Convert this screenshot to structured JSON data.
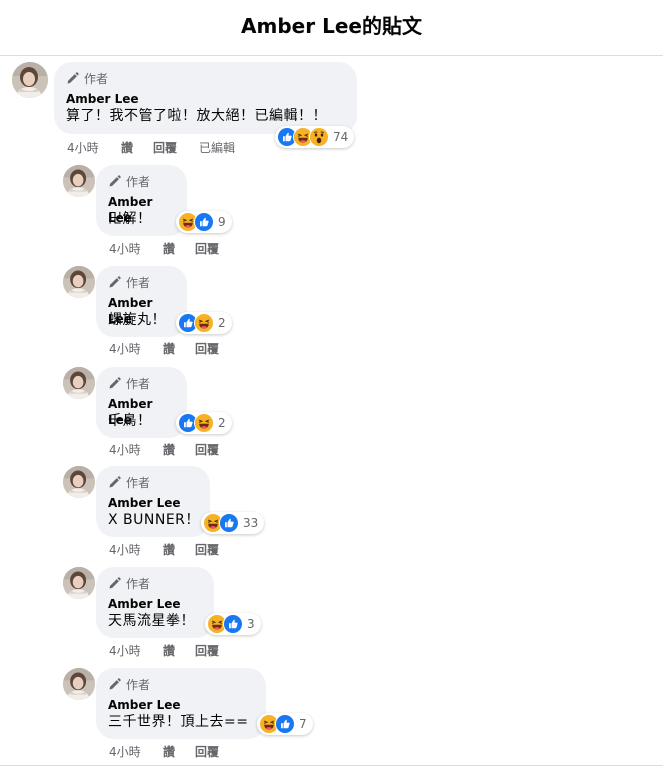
{
  "header": {
    "title": "Amber Lee的貼文"
  },
  "author_badge_label": "作者",
  "comments": [
    {
      "name": "Amber Lee",
      "text": "算了！我不管了啦！放大絕！已編輯！！",
      "time": "4小時",
      "like": "讚",
      "reply": "回覆",
      "edited": "已編輯",
      "reactions": [
        "like",
        "haha",
        "wow"
      ],
      "count": "74"
    },
    {
      "name": "Amber Lee",
      "text": "卍解！",
      "time": "4小時",
      "like": "讚",
      "reply": "回覆",
      "reactions": [
        "haha",
        "like"
      ],
      "count": "9"
    },
    {
      "name": "Amber Lee",
      "text": "螺旋丸！",
      "time": "4小時",
      "like": "讚",
      "reply": "回覆",
      "reactions": [
        "like",
        "haha"
      ],
      "count": "2"
    },
    {
      "name": "Amber Lee",
      "text": "千鳥！",
      "time": "4小時",
      "like": "讚",
      "reply": "回覆",
      "reactions": [
        "like",
        "haha"
      ],
      "count": "2"
    },
    {
      "name": "Amber Lee",
      "text": "X BUNNER！",
      "time": "4小時",
      "like": "讚",
      "reply": "回覆",
      "reactions": [
        "haha",
        "like"
      ],
      "count": "33"
    },
    {
      "name": "Amber Lee",
      "text": "天馬流星拳！",
      "time": "4小時",
      "like": "讚",
      "reply": "回覆",
      "reactions": [
        "haha",
        "like"
      ],
      "count": "3"
    },
    {
      "name": "Amber Lee",
      "text": "三千世界！頂上去==",
      "time": "4小時",
      "like": "讚",
      "reply": "回覆",
      "reactions": [
        "haha",
        "like"
      ],
      "count": "7"
    }
  ],
  "colors": {
    "like_blue": "#1877f2",
    "haha_yellow": "#f7b125",
    "bubble_bg": "#f0f2f5",
    "meta_gray": "#65676b"
  },
  "icons": {
    "author": "pencil-icon",
    "like": "thumbs-up-icon",
    "haha": "laughing-face-icon",
    "wow": "surprised-face-icon"
  }
}
